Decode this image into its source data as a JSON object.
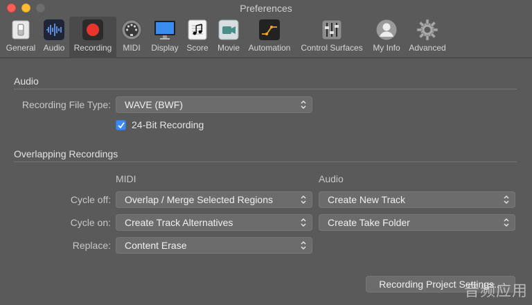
{
  "window": {
    "title": "Preferences"
  },
  "toolbar": {
    "items": [
      {
        "label": "General",
        "icon": "general-switch-icon"
      },
      {
        "label": "Audio",
        "icon": "audio-waveform-icon"
      },
      {
        "label": "Recording",
        "icon": "record-dot-icon",
        "active": true
      },
      {
        "label": "MIDI",
        "icon": "midi-connector-icon"
      },
      {
        "label": "Display",
        "icon": "display-monitor-icon"
      },
      {
        "label": "Score",
        "icon": "score-notes-icon"
      },
      {
        "label": "Movie",
        "icon": "movie-camera-icon"
      },
      {
        "label": "Automation",
        "icon": "automation-curve-icon"
      },
      {
        "label": "Control Surfaces",
        "icon": "control-faders-icon"
      },
      {
        "label": "My Info",
        "icon": "user-avatar-icon"
      },
      {
        "label": "Advanced",
        "icon": "gear-icon"
      }
    ]
  },
  "audio_section": {
    "title": "Audio",
    "file_type_label": "Recording File Type:",
    "file_type_value": "WAVE (BWF)",
    "bit_checkbox_label": "24-Bit Recording",
    "bit_checkbox_checked": true
  },
  "overlap_section": {
    "title": "Overlapping Recordings",
    "col_midi": "MIDI",
    "col_audio": "Audio",
    "cycle_off_label": "Cycle off:",
    "cycle_off_midi": "Overlap / Merge Selected Regions",
    "cycle_off_audio": "Create New Track",
    "cycle_on_label": "Cycle on:",
    "cycle_on_midi": "Create Track Alternatives",
    "cycle_on_audio": "Create Take Folder",
    "replace_label": "Replace:",
    "replace_midi": "Content Erase"
  },
  "footer": {
    "project_settings_button": "Recording Project Settings..."
  },
  "watermark": "音频应用",
  "colors": {
    "window_bg": "#5a5a5a",
    "accent_blue": "#3b89f5",
    "record_red": "#e8362e"
  }
}
